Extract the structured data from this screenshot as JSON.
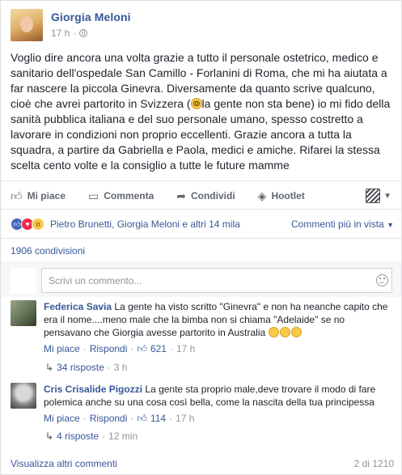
{
  "post": {
    "author": "Giorgia Meloni",
    "time": "17 h",
    "text_before": "Voglio dire ancora una volta grazie a tutto il personale ostetrico, medico e sanitario dell'ospedale San Camillo - Forlanini di Roma, che mi ha aiutata a far nascere la piccola Ginevra. Diversamente da quanto scrive qualcuno, cioè che avrei partorito in Svizzera (",
    "text_after": "la gente non sta bene) io mi fido della sanità pubblica italiana e del suo personale umano, spesso costretto a lavorare in condizioni non proprio eccellenti. Grazie ancora a tutta la squadra, a partire da Gabriella e Paola, medici e amiche. Rifarei la stessa scelta cento volte e la consiglio a tutte le future mamme"
  },
  "actions": {
    "like": "Mi piace",
    "comment": "Commenta",
    "share": "Condividi",
    "hootlet": "Hootlet"
  },
  "reactions": {
    "names": "Pietro Brunetti, Giorgia Meloni e altri 14 mila",
    "order": "Commenti più in vista"
  },
  "shares": "1906 condivisioni",
  "comment_input": {
    "placeholder": "Scrivi un commento..."
  },
  "comments": [
    {
      "name": "Federica Savia",
      "text": "La gente ha visto scritto \"Ginevra\" e non ha neanche capito che era il nome....meno male che la bimba non si chiama \"Adelaide\" se no pensavano che Giorgia avesse partorito in Australia",
      "like": "Mi piace",
      "reply": "Rispondi",
      "likes": "621",
      "time": "17 h",
      "replies": "34 risposte",
      "replies_time": "3 h"
    },
    {
      "name": "Cris Crisalide Pigozzi",
      "text": "La gente sta proprio male,deve trovare il modo di fare polemica anche su una cosa così bella, come la nascita della tua principessa",
      "like": "Mi piace",
      "reply": "Rispondi",
      "likes": "114",
      "time": "17 h",
      "replies": "4 risposte",
      "replies_time": "12 min"
    }
  ],
  "footer": {
    "more": "Visualizza altri commenti",
    "count": "2 di 1210"
  },
  "colors": {
    "link": "#365899",
    "like_reaction": "#4267b2",
    "love_reaction": "#f0284a",
    "wow_reaction": "#f7c948"
  }
}
